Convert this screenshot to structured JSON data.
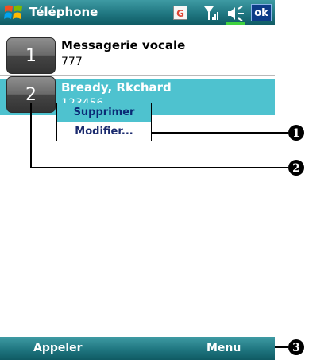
{
  "titlebar": {
    "title": "Téléphone",
    "status_letter": "G",
    "ok_label": "ok"
  },
  "speed_dial": [
    {
      "slot": "1",
      "name": "Messagerie vocale",
      "number": "777"
    },
    {
      "slot": "2",
      "name": "Bready, Rkchard",
      "number": "123456"
    }
  ],
  "context_menu": {
    "items": [
      "Supprimer",
      "Modifier..."
    ]
  },
  "callouts": [
    "1",
    "2",
    "3"
  ],
  "softkeys": {
    "left": "Appeler",
    "right": "Menu"
  },
  "colors": {
    "bar": "#1f7680",
    "selection": "#4ec2cf",
    "battery": "#3fd23f",
    "ok_button": "#0c3c87"
  }
}
